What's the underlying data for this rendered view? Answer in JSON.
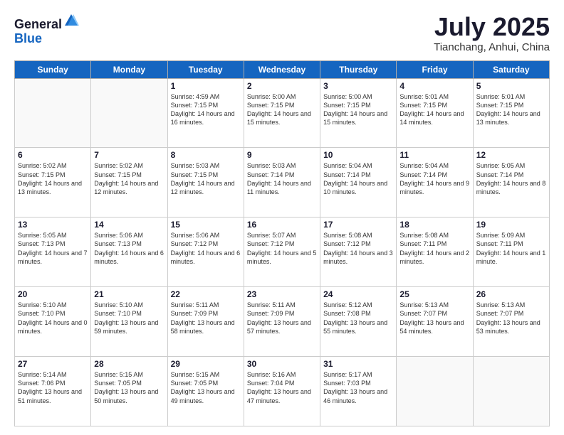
{
  "logo": {
    "general": "General",
    "blue": "Blue"
  },
  "header": {
    "month": "July 2025",
    "location": "Tianchang, Anhui, China"
  },
  "days_of_week": [
    "Sunday",
    "Monday",
    "Tuesday",
    "Wednesday",
    "Thursday",
    "Friday",
    "Saturday"
  ],
  "weeks": [
    [
      {
        "day": "",
        "info": ""
      },
      {
        "day": "",
        "info": ""
      },
      {
        "day": "1",
        "info": "Sunrise: 4:59 AM\nSunset: 7:15 PM\nDaylight: 14 hours and 16 minutes."
      },
      {
        "day": "2",
        "info": "Sunrise: 5:00 AM\nSunset: 7:15 PM\nDaylight: 14 hours and 15 minutes."
      },
      {
        "day": "3",
        "info": "Sunrise: 5:00 AM\nSunset: 7:15 PM\nDaylight: 14 hours and 15 minutes."
      },
      {
        "day": "4",
        "info": "Sunrise: 5:01 AM\nSunset: 7:15 PM\nDaylight: 14 hours and 14 minutes."
      },
      {
        "day": "5",
        "info": "Sunrise: 5:01 AM\nSunset: 7:15 PM\nDaylight: 14 hours and 13 minutes."
      }
    ],
    [
      {
        "day": "6",
        "info": "Sunrise: 5:02 AM\nSunset: 7:15 PM\nDaylight: 14 hours and 13 minutes."
      },
      {
        "day": "7",
        "info": "Sunrise: 5:02 AM\nSunset: 7:15 PM\nDaylight: 14 hours and 12 minutes."
      },
      {
        "day": "8",
        "info": "Sunrise: 5:03 AM\nSunset: 7:15 PM\nDaylight: 14 hours and 12 minutes."
      },
      {
        "day": "9",
        "info": "Sunrise: 5:03 AM\nSunset: 7:14 PM\nDaylight: 14 hours and 11 minutes."
      },
      {
        "day": "10",
        "info": "Sunrise: 5:04 AM\nSunset: 7:14 PM\nDaylight: 14 hours and 10 minutes."
      },
      {
        "day": "11",
        "info": "Sunrise: 5:04 AM\nSunset: 7:14 PM\nDaylight: 14 hours and 9 minutes."
      },
      {
        "day": "12",
        "info": "Sunrise: 5:05 AM\nSunset: 7:14 PM\nDaylight: 14 hours and 8 minutes."
      }
    ],
    [
      {
        "day": "13",
        "info": "Sunrise: 5:05 AM\nSunset: 7:13 PM\nDaylight: 14 hours and 7 minutes."
      },
      {
        "day": "14",
        "info": "Sunrise: 5:06 AM\nSunset: 7:13 PM\nDaylight: 14 hours and 6 minutes."
      },
      {
        "day": "15",
        "info": "Sunrise: 5:06 AM\nSunset: 7:12 PM\nDaylight: 14 hours and 6 minutes."
      },
      {
        "day": "16",
        "info": "Sunrise: 5:07 AM\nSunset: 7:12 PM\nDaylight: 14 hours and 5 minutes."
      },
      {
        "day": "17",
        "info": "Sunrise: 5:08 AM\nSunset: 7:12 PM\nDaylight: 14 hours and 3 minutes."
      },
      {
        "day": "18",
        "info": "Sunrise: 5:08 AM\nSunset: 7:11 PM\nDaylight: 14 hours and 2 minutes."
      },
      {
        "day": "19",
        "info": "Sunrise: 5:09 AM\nSunset: 7:11 PM\nDaylight: 14 hours and 1 minute."
      }
    ],
    [
      {
        "day": "20",
        "info": "Sunrise: 5:10 AM\nSunset: 7:10 PM\nDaylight: 14 hours and 0 minutes."
      },
      {
        "day": "21",
        "info": "Sunrise: 5:10 AM\nSunset: 7:10 PM\nDaylight: 13 hours and 59 minutes."
      },
      {
        "day": "22",
        "info": "Sunrise: 5:11 AM\nSunset: 7:09 PM\nDaylight: 13 hours and 58 minutes."
      },
      {
        "day": "23",
        "info": "Sunrise: 5:11 AM\nSunset: 7:09 PM\nDaylight: 13 hours and 57 minutes."
      },
      {
        "day": "24",
        "info": "Sunrise: 5:12 AM\nSunset: 7:08 PM\nDaylight: 13 hours and 55 minutes."
      },
      {
        "day": "25",
        "info": "Sunrise: 5:13 AM\nSunset: 7:07 PM\nDaylight: 13 hours and 54 minutes."
      },
      {
        "day": "26",
        "info": "Sunrise: 5:13 AM\nSunset: 7:07 PM\nDaylight: 13 hours and 53 minutes."
      }
    ],
    [
      {
        "day": "27",
        "info": "Sunrise: 5:14 AM\nSunset: 7:06 PM\nDaylight: 13 hours and 51 minutes."
      },
      {
        "day": "28",
        "info": "Sunrise: 5:15 AM\nSunset: 7:05 PM\nDaylight: 13 hours and 50 minutes."
      },
      {
        "day": "29",
        "info": "Sunrise: 5:15 AM\nSunset: 7:05 PM\nDaylight: 13 hours and 49 minutes."
      },
      {
        "day": "30",
        "info": "Sunrise: 5:16 AM\nSunset: 7:04 PM\nDaylight: 13 hours and 47 minutes."
      },
      {
        "day": "31",
        "info": "Sunrise: 5:17 AM\nSunset: 7:03 PM\nDaylight: 13 hours and 46 minutes."
      },
      {
        "day": "",
        "info": ""
      },
      {
        "day": "",
        "info": ""
      }
    ]
  ]
}
